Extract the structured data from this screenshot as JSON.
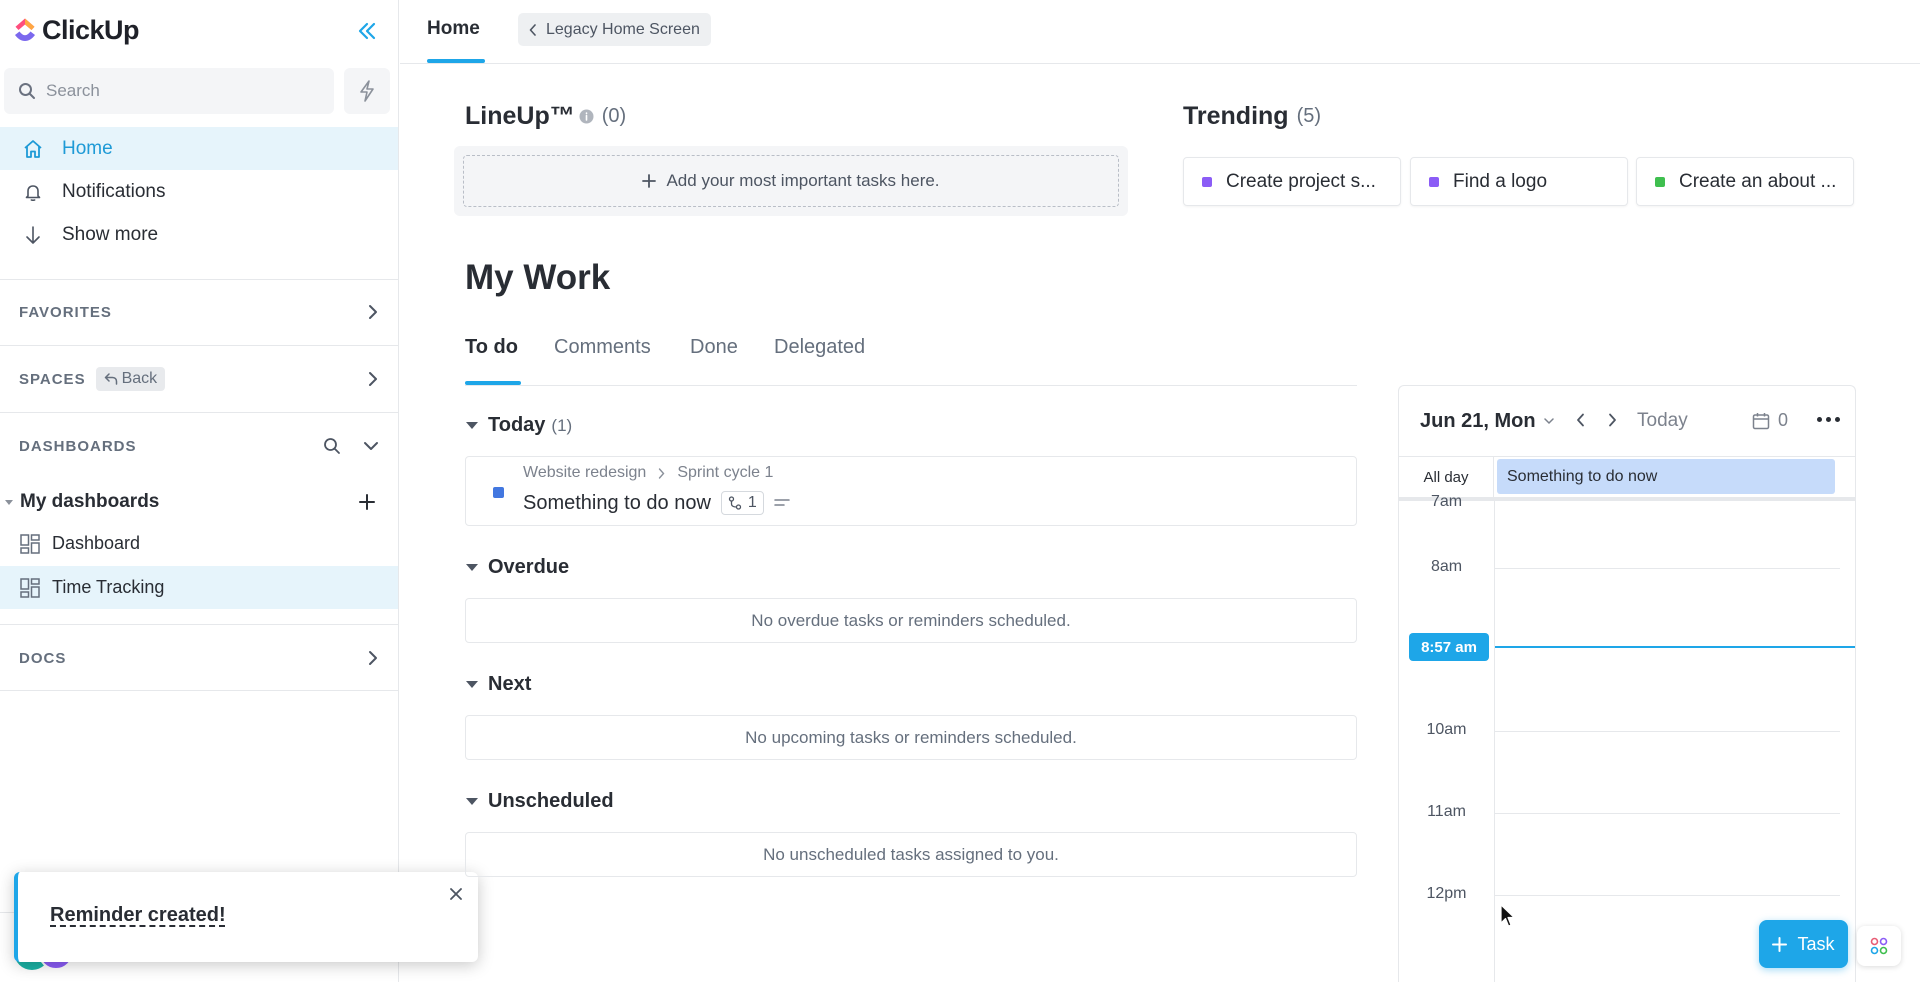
{
  "app": {
    "name": "ClickUp"
  },
  "sidebar": {
    "search_placeholder": "Search",
    "nav": [
      {
        "label": "Home",
        "icon": "home-icon",
        "active": true
      },
      {
        "label": "Notifications",
        "icon": "bell-icon",
        "active": false
      },
      {
        "label": "Show more",
        "icon": "arrow-down-icon",
        "active": false
      }
    ],
    "favorites_label": "FAVORITES",
    "spaces_label": "SPACES",
    "back_label": "Back",
    "dashboards_label": "DASHBOARDS",
    "my_dashboards_label": "My dashboards",
    "dashboards": [
      {
        "label": "Dashboard",
        "active": false
      },
      {
        "label": "Time Tracking",
        "active": true
      }
    ],
    "docs_label": "DOCS"
  },
  "toast": {
    "message": "Reminder created!"
  },
  "header": {
    "tab_home": "Home",
    "legacy_label": "Legacy Home Screen"
  },
  "lineup": {
    "title": "LineUp™",
    "count": "(0)",
    "add_label": "Add your most important tasks here."
  },
  "trending": {
    "title": "Trending",
    "count": "(5)",
    "items": [
      {
        "label": "Create project s...",
        "color": "#8b5cf6"
      },
      {
        "label": "Find a logo",
        "color": "#8b5cf6"
      },
      {
        "label": "Create an about ...",
        "color": "#3fbf4f"
      }
    ]
  },
  "mywork": {
    "title": "My Work",
    "tabs": [
      "To do",
      "Comments",
      "Done",
      "Delegated"
    ],
    "today_label": "Today",
    "today_count": "(1)",
    "task": {
      "list": "Website redesign",
      "sprint": "Sprint cycle 1",
      "name": "Something to do now",
      "subtasks": "1"
    },
    "overdue_label": "Overdue",
    "overdue_empty": "No overdue tasks or reminders scheduled.",
    "next_label": "Next",
    "next_empty": "No upcoming tasks or reminders scheduled.",
    "unscheduled_label": "Unscheduled",
    "unscheduled_empty": "No unscheduled tasks assigned to you."
  },
  "calendar": {
    "date": "Jun 21, Mon",
    "today_label": "Today",
    "event_count": "0",
    "allday_label": "All day",
    "allday_event": "Something to do now",
    "hours": [
      "7am",
      "8am",
      "10am",
      "11am",
      "12pm"
    ],
    "now_label": "8:57 am"
  },
  "task_button": {
    "label": "Task"
  },
  "colors": {
    "accent": "#1ea6e8",
    "active_bg": "#e6f4fb",
    "event_bg": "#c6dbfa"
  }
}
